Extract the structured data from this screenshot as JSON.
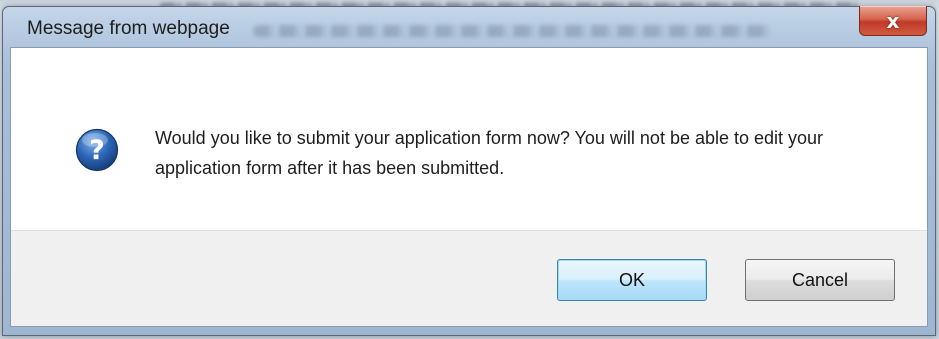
{
  "window": {
    "title": "Message from webpage",
    "close_label": "x"
  },
  "dialog": {
    "icon": "question-icon",
    "message": "Would you like to submit your application form now? You will not be able to edit your application form after it has been submitted.",
    "ok_label": "OK",
    "cancel_label": "Cancel"
  },
  "colors": {
    "close_button": "#c0392b",
    "question_icon": "#1e5aa8",
    "default_button_border": "#3c7fb1"
  }
}
